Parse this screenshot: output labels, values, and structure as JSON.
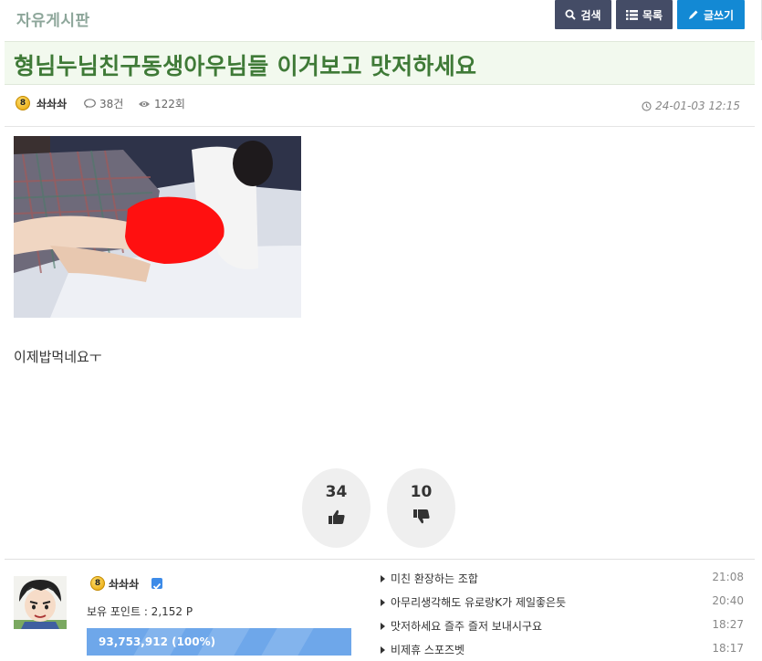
{
  "board": {
    "name": "자유게시판"
  },
  "toolbar": {
    "search_label": "검색",
    "list_label": "목록",
    "write_label": "글쓰기"
  },
  "post": {
    "title": "형님누님친구동생아우님들 이거보고 맛저하세요",
    "author": "솨솨솨",
    "author_level": "8",
    "comments": "38건",
    "views": "122회",
    "date": "24-01-03 12:15",
    "body": "이제밥먹네요ㅜ"
  },
  "votes": {
    "up": "34",
    "down": "10"
  },
  "profile": {
    "name": "솨솨솨",
    "level": "8",
    "points": "보유 포인트 : 2,152 P",
    "xp_text": "93,753,912 (100%)",
    "xp_progress": 1.0
  },
  "recent_posts": [
    {
      "title": "미친 환장하는 조합",
      "time": "21:08"
    },
    {
      "title": "아무리생각해도 유로랑K가 제일좋은듯",
      "time": "20:40"
    },
    {
      "title": "맛저하세요 즐주 즐저 보내시구요",
      "time": "18:27"
    },
    {
      "title": "비제휴 스포즈벳",
      "time": "18:17"
    }
  ],
  "colors": {
    "accent_green": "#3f7a37",
    "button_dark": "#444c66",
    "button_blue": "#1389d4",
    "xp_bar": "#6ea7ea"
  }
}
